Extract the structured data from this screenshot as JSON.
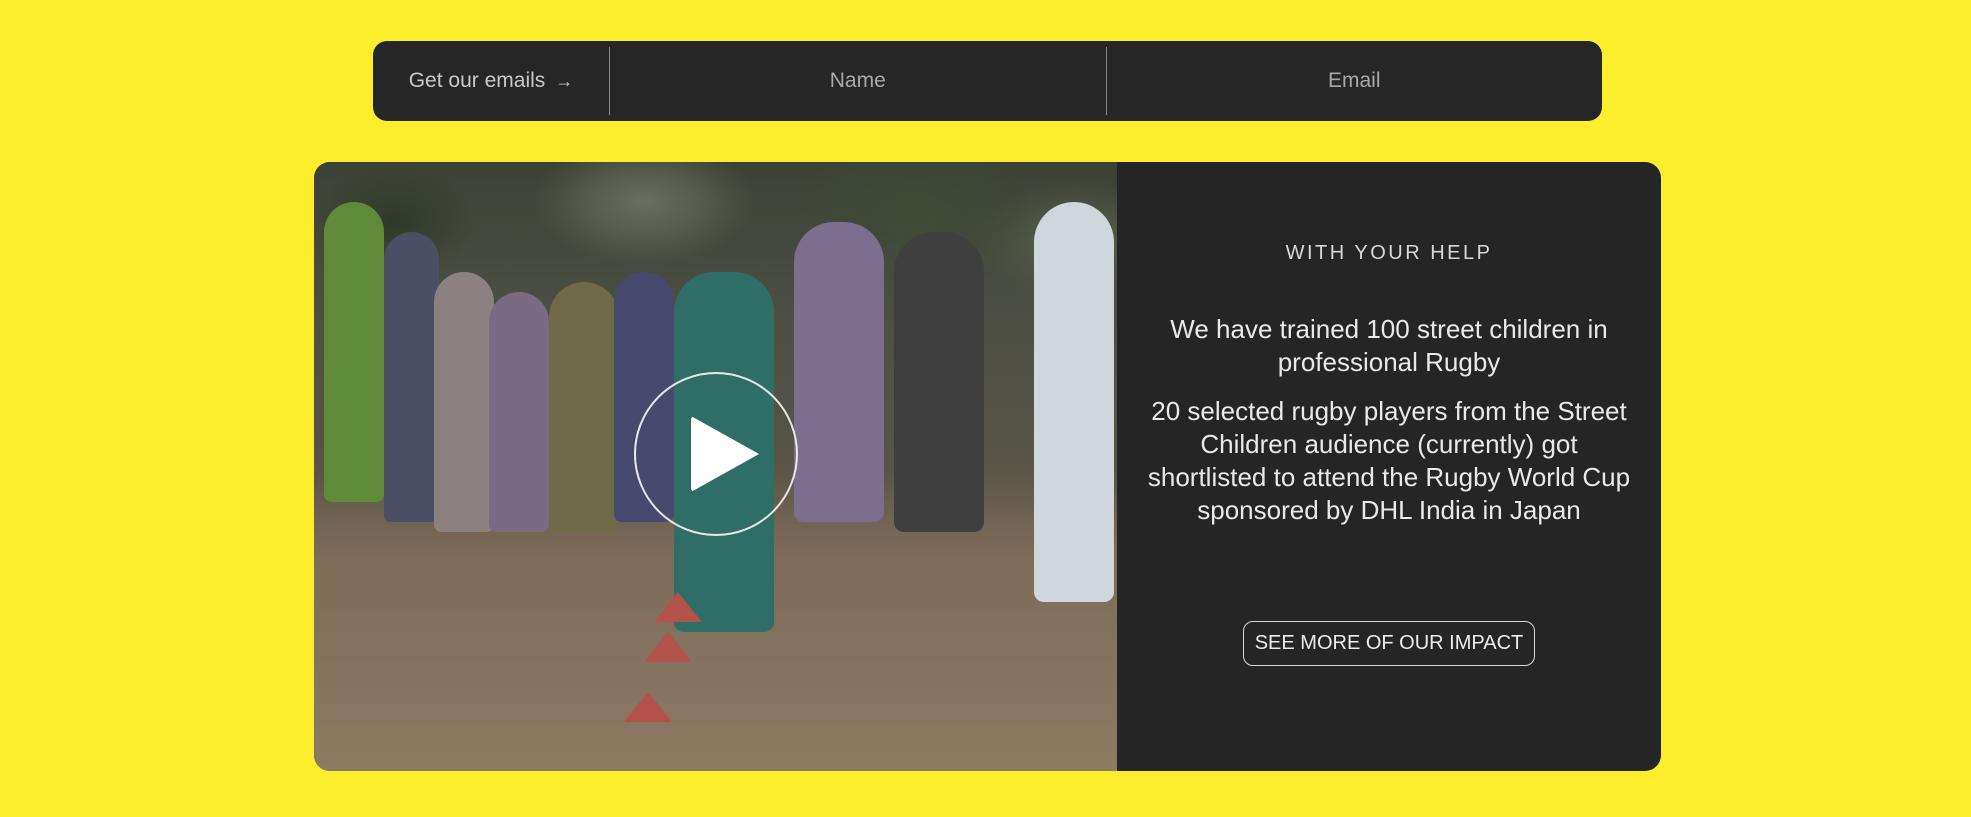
{
  "signup": {
    "cta_label": "Get our emails",
    "cta_icon": "arrow-right-icon",
    "name_placeholder": "Name",
    "email_placeholder": "Email"
  },
  "colors": {
    "page_background": "#FCEE2C",
    "panel_background": "#252525"
  },
  "video": {
    "play_icon": "play-icon"
  },
  "impact": {
    "eyebrow": "WITH YOUR HELP",
    "stat_one": "We have trained 100 street children in professional Rugby",
    "stat_two": "20 selected rugby players from the Street Children audience (currently) got shortlisted to attend the Rugby World Cup sponsored by DHL India in Japan",
    "button_label": "SEE MORE OF OUR IMPACT"
  }
}
